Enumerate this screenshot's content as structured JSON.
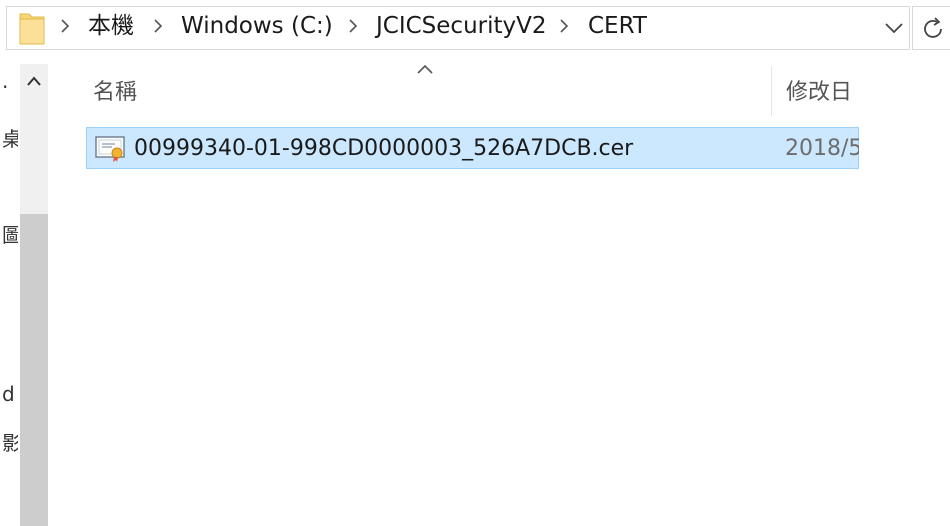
{
  "breadcrumb": {
    "items": [
      {
        "label": "本機"
      },
      {
        "label": "Windows (C:)"
      },
      {
        "label": "JCICSecurityV2"
      },
      {
        "label": "CERT"
      }
    ],
    "separator_icon": "chevron-right-icon",
    "dropdown_icon": "chevron-down-icon",
    "refresh_icon": "refresh-icon"
  },
  "nav_pane": {
    "fragments": [
      "·",
      "桌",
      "圖",
      "d",
      "影"
    ],
    "scroll_up_icon": "chevron-up-icon"
  },
  "columns": {
    "name": "名稱",
    "modified": "修改日"
  },
  "files": [
    {
      "name": "00999340-01-998CD0000003_526A7DCB.cer",
      "modified": "2018/5",
      "icon": "certificate-icon",
      "selected": true
    }
  ],
  "colors": {
    "selection_bg": "#cce8ff",
    "selection_border": "#99d1ff",
    "folder_yellow": "#f8d775"
  }
}
